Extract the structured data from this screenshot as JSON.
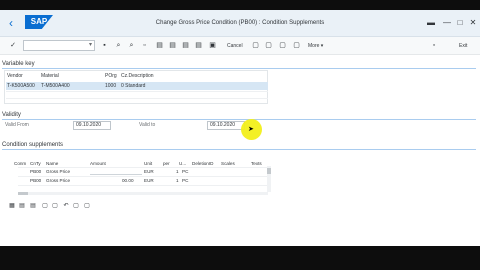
{
  "window": {
    "title": "Change Gross Price Condition (PB00) : Condition Supplements",
    "back_glyph": "‹",
    "logo_text": "SAP",
    "controls": {
      "flag_glyph": "▬",
      "minimize": "—",
      "maximize": "□",
      "close": "✕"
    }
  },
  "toolbar": {
    "check_glyph": "✓",
    "command_caret": "▾",
    "cancel_label": "Cancel",
    "more_label": "More",
    "more_caret": "▾",
    "exit_label": "Exit",
    "icons": [
      "save",
      "find",
      "find-next",
      "info",
      "first-page",
      "previous-page",
      "next-page",
      "last-page",
      "copy",
      "delete",
      "execute",
      "pricing-report",
      "other-condition",
      "display-toggle"
    ]
  },
  "variable_key": {
    "section_title": "Variable key",
    "columns": [
      "Vendor",
      "Material",
      "POrg",
      "Cz.Description"
    ],
    "row": [
      "T-K500A500",
      "T-M500A400",
      "1000",
      "0 Standard"
    ]
  },
  "validity": {
    "section_title": "Validity",
    "valid_from_label": "Valid From",
    "valid_from_value": "09.10.2020",
    "valid_to_label": "Valid to",
    "valid_to_value": "09.10.2020"
  },
  "condition_supplements": {
    "section_title": "Condition supplements",
    "columns": [
      "Conm",
      "CnTy",
      "Name",
      "Amount",
      "Unit",
      "per",
      "U...",
      "DeletionID",
      "Scales",
      "Texts"
    ],
    "rows": [
      {
        "cnty": "PB00",
        "name": "Gross Price",
        "amount": "",
        "unit": "EUR",
        "per": "1",
        "uom": "PC"
      },
      {
        "cnty": "PB00",
        "name": "Gross Price",
        "amount": "00.00",
        "unit": "EUR",
        "per": "1",
        "uom": "PC"
      }
    ]
  }
}
